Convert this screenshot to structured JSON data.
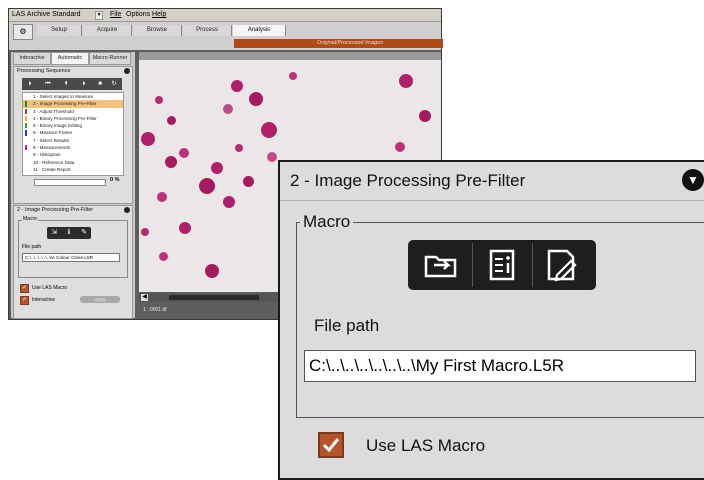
{
  "app": {
    "title": "LAS Archive Standard",
    "menus": [
      "File",
      "Options",
      "Help"
    ]
  },
  "workflow_tabs": [
    "Setup",
    "Acquire",
    "Browse",
    "Process",
    "Analysis"
  ],
  "active_workflow_tab": "Analysis",
  "image_view_label": "Original/Processed Images",
  "panel_tabs": [
    "Interactive",
    "Automatic",
    "Macro Runner"
  ],
  "processing_sequence": {
    "title": "Processing Sequence",
    "steps": [
      "1 - Select Images to Measure",
      "2 - Image Processing Pre-Filter",
      "3 - Adjust Threshold",
      "4 - Binary Processing Pre-Filter",
      "5 - Binary Image Editing",
      "6 - Measure Frame",
      "7 - Select Results",
      "8 - Measurements",
      "9 - Histogram",
      "10 - Reference Data",
      "11 - Create Report"
    ],
    "progress_text": "0 %"
  },
  "prefilter_small": {
    "title": "2 - Image Processing Pre-Filter",
    "macro_legend": "Macro",
    "file_path_label": "File path",
    "file_path_value": "C:\\..\\..\\..\\..\\..\\IA Colour Close.L5R",
    "use_las_macro": "Use LAS Macro",
    "interactive": "Interactive",
    "apply": "Apply"
  },
  "viewer_status": "1 : 0001.tif",
  "zoom": {
    "title": "2 - Image Processing Pre-Filter",
    "macro_legend": "Macro",
    "file_path_label": "File path",
    "file_path_value": "C:\\..\\..\\..\\..\\..\\..\\My First Macro.L5R",
    "use_las_macro": "Use LAS Macro"
  },
  "colors": {
    "accent_orange": "#b04a16",
    "checkbox": "#b4542a",
    "cell_stain": "#b0206a"
  }
}
